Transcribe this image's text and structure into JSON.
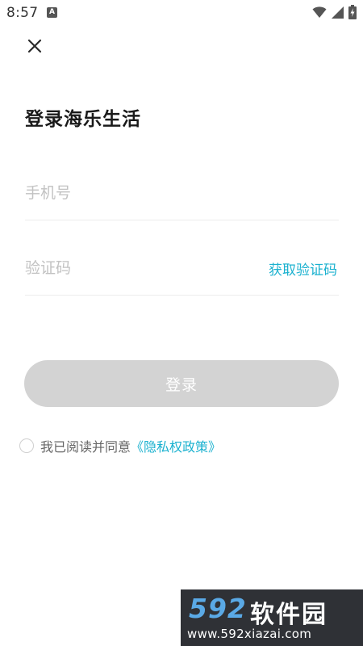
{
  "status_bar": {
    "time": "8:57",
    "notification_icon": "a-notification-icon",
    "wifi_icon": "wifi-icon",
    "signal_icon": "signal-icon",
    "battery_icon": "battery-icon"
  },
  "header": {
    "close_icon": "close-icon"
  },
  "main": {
    "title": "登录海乐生活",
    "phone_placeholder": "手机号",
    "code_placeholder": "验证码",
    "get_code_label": "获取验证码",
    "login_label": "登录",
    "agreement_text": "我已阅读并同意",
    "privacy_link": "《隐私权政策》"
  },
  "watermark": {
    "brand": "592",
    "brand_cn": "软件园",
    "url": "www.592xiazai.com"
  },
  "colors": {
    "accent": "#1ab1cf",
    "login_button_disabled": "#d3d3d3",
    "placeholder": "#c2c2c2"
  }
}
